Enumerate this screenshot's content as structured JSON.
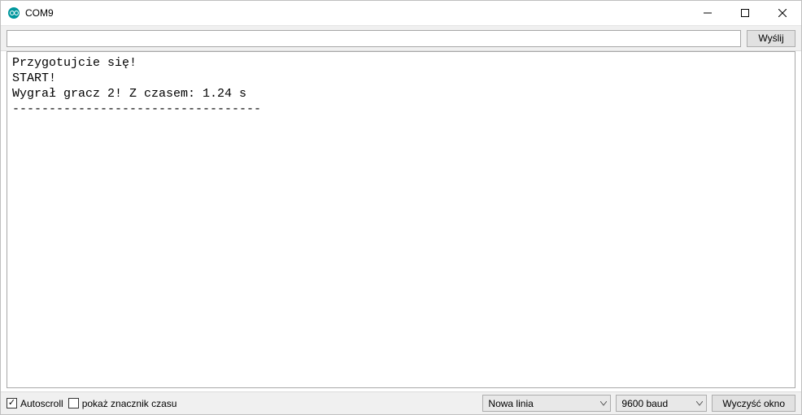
{
  "window": {
    "title": "COM9",
    "icon": "arduino-icon",
    "accent": "#00979D"
  },
  "toolbar": {
    "input_value": "",
    "input_placeholder": "",
    "send_label": "Wyślij"
  },
  "console": {
    "lines": [
      "Przygotujcie się!",
      "START!",
      "Wygrał gracz 2! Z czasem: 1.24 s",
      "----------------------------------"
    ]
  },
  "bottom": {
    "autoscroll_label": "Autoscroll",
    "autoscroll_checked": true,
    "timestamp_label": "pokaż znacznik czasu",
    "timestamp_checked": false,
    "line_ending_selected": "Nowa linia",
    "baud_selected": "9600 baud",
    "clear_label": "Wyczyść okno"
  }
}
